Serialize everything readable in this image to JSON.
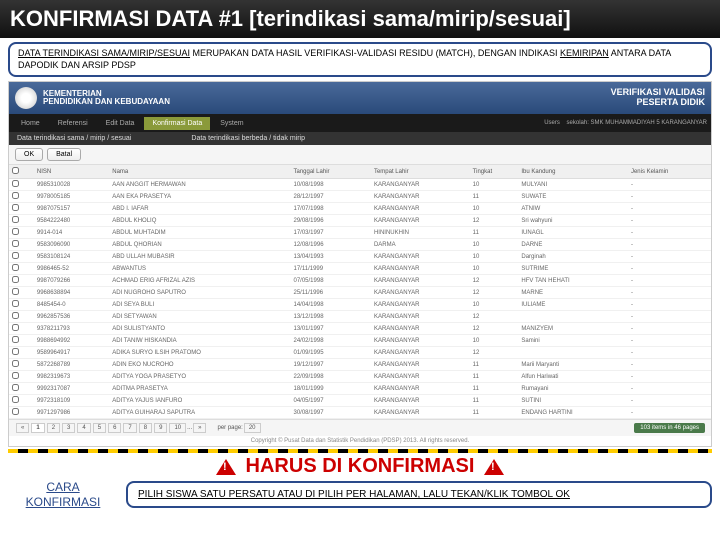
{
  "slide": {
    "title": "KONFIRMASI DATA #1 [terindikasi sama/mirip/sesuai]"
  },
  "desc": {
    "p1": "DATA TERINDIKASI SAMA/MIRIP/SESUAI",
    "p2": " MERUPAKAN DATA HASIL VERIFIKASI-VALIDASI RESIDU (MATCH), DENGAN INDIKASI ",
    "p3": "KEMIRIPAN",
    "p4": " ANTARA DATA DAPODIK DAN ARSIP PDSP"
  },
  "hdr": {
    "t1": "KEMENTERIAN",
    "t2": "PENDIDIKAN DAN KEBUDAYAAN",
    "r1": "VERIFIKASI VALIDASI",
    "r2": "PESERTA DIDIK"
  },
  "nav": {
    "items": [
      "Home",
      "Referensi",
      "Edit Data",
      "Konfirmasi Data",
      "System"
    ],
    "active": 3,
    "right": "Users    sekolah: SMK MUHAMMADIYAH 5 KARANGANYAR"
  },
  "sub": {
    "l": "Data terindikasi sama / mirip / sesuai",
    "r": "Data terindikasi berbeda / tidak mirip"
  },
  "btns": {
    "ok": "OK",
    "batal": "Batal"
  },
  "cols": [
    "",
    "NISN",
    "Nama",
    "Tanggal Lahir",
    "Tempat Lahir",
    "Tingkat",
    "Ibu Kandung",
    "Jenis Kelamin"
  ],
  "rows": [
    [
      "9985310028",
      "AAN ANGGIT HERMAWAN",
      "10/08/1998",
      "KARANGANYAR",
      "10",
      "MULYANI",
      "-"
    ],
    [
      "9978005185",
      "AAN EKA PRASETYA",
      "28/12/1997",
      "KARANGANYAR",
      "11",
      "SUWATE",
      "-"
    ],
    [
      "9987075157",
      "ABD I. IAFAR",
      "17/07/1998",
      "KARANGANYAR",
      "10",
      "ATNIW",
      "-"
    ],
    [
      "9584222480",
      "ABDUL KHOLIQ",
      "29/08/1996",
      "KARANGANYAR",
      "12",
      "Sri wahyuni",
      "-"
    ],
    [
      "9914-014",
      "ABDUL MUHTADIM",
      "17/03/1997",
      "HININUKHIN",
      "11",
      "IUNAGL",
      "-"
    ],
    [
      "9583096090",
      "ABDUL QHORIAN",
      "12/08/1996",
      "DARMA",
      "10",
      "DARNE",
      "-"
    ],
    [
      "9583108124",
      "ABD ULLAH MUBASIR",
      "13/04/1993",
      "KARANGANYAR",
      "10",
      "Darginah",
      "-"
    ],
    [
      "9986465-52",
      "ABWANTUS",
      "17/11/1999",
      "KARANGANYAR",
      "10",
      "SUTRIME",
      "-"
    ],
    [
      "9987079266",
      "ACHMAD ERIG AFRIZAL AZIS",
      "07/05/1998",
      "KARANGANYAR",
      "12",
      "HFV TAN HEHATI",
      "-"
    ],
    [
      "9968638894",
      "ADI NUGROHO SAPUTRO",
      "25/11/1996",
      "KARANGANYAR",
      "12",
      "MARNE",
      "-"
    ],
    [
      "8485454-0",
      "ADI SEYA BULI",
      "14/04/1998",
      "KARANGANYAR",
      "10",
      "IULIAME",
      "-"
    ],
    [
      "9962857536",
      "ADI SETYAWAN",
      "13/12/1998",
      "KARANGANYAR",
      "12",
      "",
      "-"
    ],
    [
      "9378211793",
      "ADI SULISTYANTO",
      "13/01/1997",
      "KARANGANYAR",
      "12",
      "MANIZYEM",
      "-"
    ],
    [
      "9988694992",
      "ADI TANIW HISKANDIA",
      "24/02/1998",
      "KARANGANYAR",
      "10",
      "Samini",
      "-"
    ],
    [
      "9589964917",
      "ADIKA SURYO ILSIH PRATOMO",
      "01/09/1995",
      "KARANGANYAR",
      "12",
      "",
      "-"
    ],
    [
      "5872268789",
      "ADIN EKO NUCROHO",
      "19/12/1997",
      "KARANGANYAR",
      "11",
      "Marii Maryanti",
      "-"
    ],
    [
      "9982319673",
      "ADITYA YOGA PRASETYO",
      "22/09/1998",
      "KARANGANYAR",
      "11",
      "Alfun Hariwati",
      "-"
    ],
    [
      "9992317087",
      "ADITMA PRASETYA",
      "18/01/1999",
      "KARANGANYAR",
      "11",
      "Rumayani",
      "-"
    ],
    [
      "9972318109",
      "ADITYA YAJUS IANFURO",
      "04/05/1997",
      "KARANGANYAR",
      "11",
      "SUTINI",
      "-"
    ],
    [
      "9971297986",
      "ADITYA GUIHARAJ SAPUTRA",
      "30/08/1997",
      "KARANGANYAR",
      "11",
      "ENDANG HARTINI",
      "-"
    ]
  ],
  "pgr": {
    "pages": [
      "1",
      "2",
      "3",
      "4",
      "5",
      "6",
      "7",
      "8",
      "9",
      "10"
    ],
    "sep": "...",
    "per": "per page:",
    "perval": "20",
    "r": "103 items in 46 pages"
  },
  "ftr": "Copyright © Pusat Data dan Statistik Pendidikan (PDSP) 2013. All rights reserved.",
  "warn": "HARUS DI KONFIRMASI",
  "cara": "CARA KONFIRMASI",
  "inst": "PILIH SISWA SATU PERSATU ATAU DI PILIH PER HALAMAN, LALU TEKAN/KLIK TOMBOL OK"
}
